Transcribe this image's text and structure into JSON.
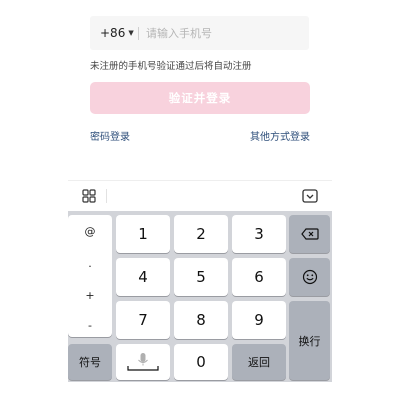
{
  "form": {
    "country_code": "+86",
    "phone_placeholder": "请输入手机号",
    "phone_value": "",
    "hint": "未注册的手机号验证通过后将自动注册",
    "submit_label": "验证并登录",
    "password_login": "密码登录",
    "other_login": "其他方式登录"
  },
  "keyboard": {
    "symbols": [
      "@",
      ".",
      "+",
      "-"
    ],
    "digits": [
      "1",
      "2",
      "3",
      "4",
      "5",
      "6",
      "7",
      "8",
      "9",
      "0"
    ],
    "symbol_key": "符号",
    "back_key": "返回",
    "newline_key": "换行"
  },
  "colors": {
    "primary_disabled": "#f8d2dd",
    "link": "#2d4e7a",
    "keyboard_bg": "#d2d4d9"
  },
  "icons": {
    "toolbar_left": "grid-icon",
    "toolbar_right": "keyboard-hide-icon",
    "backspace": "backspace-icon",
    "emoji": "emoji-icon",
    "space_mic": "microphone-icon"
  }
}
